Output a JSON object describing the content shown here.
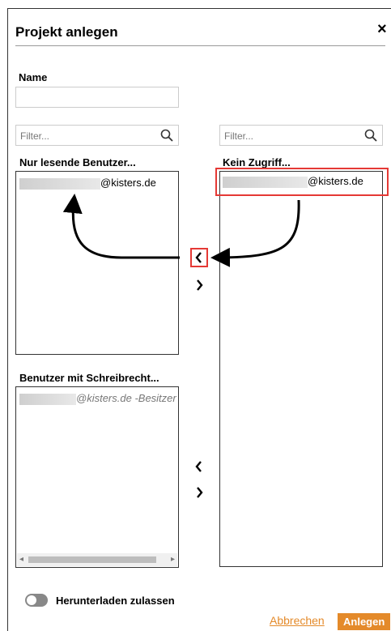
{
  "dialog": {
    "title": "Projekt anlegen",
    "close_label": "×"
  },
  "name_field": {
    "label": "Name",
    "value": ""
  },
  "filters": {
    "left_placeholder": "Filter...",
    "right_placeholder": "Filter..."
  },
  "lists": {
    "read_only": {
      "header": "Nur lesende Benutzer...",
      "items": [
        {
          "suffix": "@kisters.de"
        }
      ]
    },
    "writers": {
      "header": "Benutzer mit Schreibrecht...",
      "items": [
        {
          "suffix": "@kisters.de -Besitzer"
        }
      ]
    },
    "no_access": {
      "header": "Kein Zugriff...",
      "items": [
        {
          "suffix": "@kisters.de"
        }
      ]
    }
  },
  "transfer": {
    "left_arrow": "‹",
    "right_arrow": "›"
  },
  "icons": {
    "filter": "search-icon",
    "move_left": "chevron-left-icon",
    "move_right": "chevron-right-icon"
  },
  "download_toggle": {
    "label": "Herunterladen zulassen",
    "enabled": false
  },
  "footer": {
    "cancel_label": "Abbrechen",
    "create_label": "Anlegen"
  },
  "colors": {
    "accent": "#e48a2a",
    "highlight": "#e53935"
  }
}
